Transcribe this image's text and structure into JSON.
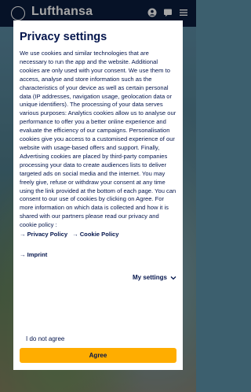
{
  "app": {
    "brand": "Lufthansa",
    "header_icons": [
      "account-icon",
      "chat-icon",
      "menu-icon"
    ]
  },
  "dialog": {
    "title": "Privacy settings",
    "body": "We use cookies and similar technologies that are necessary to run the app and the website. Additional cookies are only used with your consent. We use them to access, analyse and store information such as the characteristics of your device as well as certain personal data (IP addresses, navigation usage, geolocation data or unique identifiers). The processing of your data serves various purposes: Analytics cookies allow us to analyse our performance to offer you a better online experience and evaluate the efficiency of our campaigns. Personalisation cookies give you access to a customised experience of our website with usage-based offers and support. Finally, Advertising cookies are placed by third-party companies processing your data to create audiences lists to deliver targeted ads on social media and the internet. You may freely give, refuse or withdraw your consent at any time using the link provided at the bottom of each page. You can consent to our use of cookies by clicking on Agree. For more information on which data is collected and how it is shared with our partners please read our privacy and cookie policy :",
    "privacy_policy_link": "Privacy Policy",
    "cookie_policy_link": "Cookie Policy",
    "imprint_link": "Imprint",
    "my_settings_label": "My settings",
    "not_agree_label": "I do not agree",
    "agree_label": "Agree"
  },
  "colors": {
    "navy": "#05164d",
    "header_bg": "#0a1d3d",
    "agree_button": "#ffad00"
  }
}
